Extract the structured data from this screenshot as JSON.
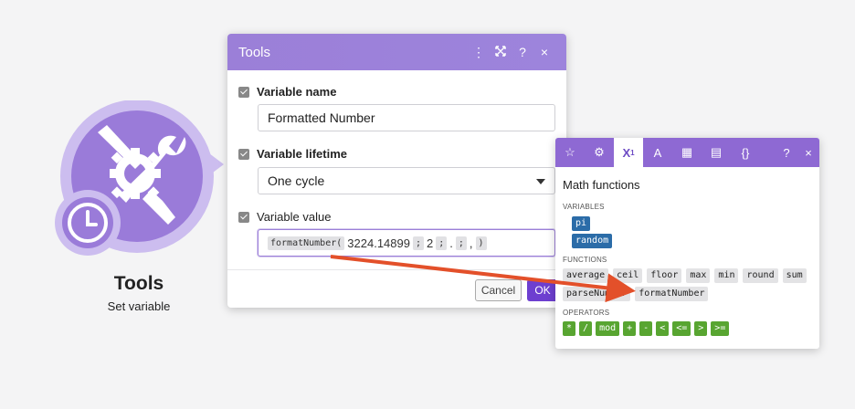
{
  "colors": {
    "accent": "#6d3fd0",
    "header": "#9b7fd8",
    "variable_chip": "#2b6ca8",
    "operator_chip": "#58a531",
    "annotation_arrow": "#e3502a"
  },
  "module": {
    "title": "Tools",
    "subtitle": "Set variable",
    "icon": "tools-icon",
    "badge_icon": "clock-icon"
  },
  "dialog": {
    "title": "Tools",
    "header_icons": [
      "more-vertical-icon",
      "expand-icon",
      "help-icon",
      "close-icon"
    ],
    "help_symbol": "?",
    "close_symbol": "×",
    "fields": {
      "variable_name": {
        "label": "Variable name",
        "value": "Formatted Number"
      },
      "variable_lifetime": {
        "label": "Variable lifetime",
        "value": "One cycle"
      },
      "variable_value": {
        "label": "Variable value",
        "function": "formatNumber(",
        "number": "3224.14899",
        "sep1": ";",
        "decimals": "2",
        "sep2": ";",
        "decimal_separator": ".",
        "sep3": ";",
        "thousands_separator": ",",
        "close": ")"
      }
    },
    "cancel_label": "Cancel",
    "ok_label": "OK"
  },
  "panel": {
    "tabs": [
      {
        "icon": "star-icon",
        "glyph": "☆"
      },
      {
        "icon": "gear-icon",
        "glyph": "⚙"
      },
      {
        "icon": "math-icon",
        "glyph": "X¹",
        "active": true
      },
      {
        "icon": "text-icon",
        "glyph": "A"
      },
      {
        "icon": "calendar-icon",
        "glyph": "▦"
      },
      {
        "icon": "table-icon",
        "glyph": "▤"
      },
      {
        "icon": "json-icon",
        "glyph": "{}"
      },
      {
        "icon": "help-icon",
        "glyph": "?"
      },
      {
        "icon": "close-icon",
        "glyph": "×"
      }
    ],
    "title": "Math functions",
    "variables_label": "VARIABLES",
    "variables": [
      "pi",
      "random"
    ],
    "functions_label": "FUNCTIONS",
    "functions": [
      "average",
      "ceil",
      "floor",
      "max",
      "min",
      "round",
      "sum",
      "parseNumber",
      "formatNumber"
    ],
    "operators_label": "OPERATORS",
    "operators": [
      "*",
      "/",
      "mod",
      "+",
      "-",
      "<",
      "<=",
      ">",
      ">="
    ]
  }
}
